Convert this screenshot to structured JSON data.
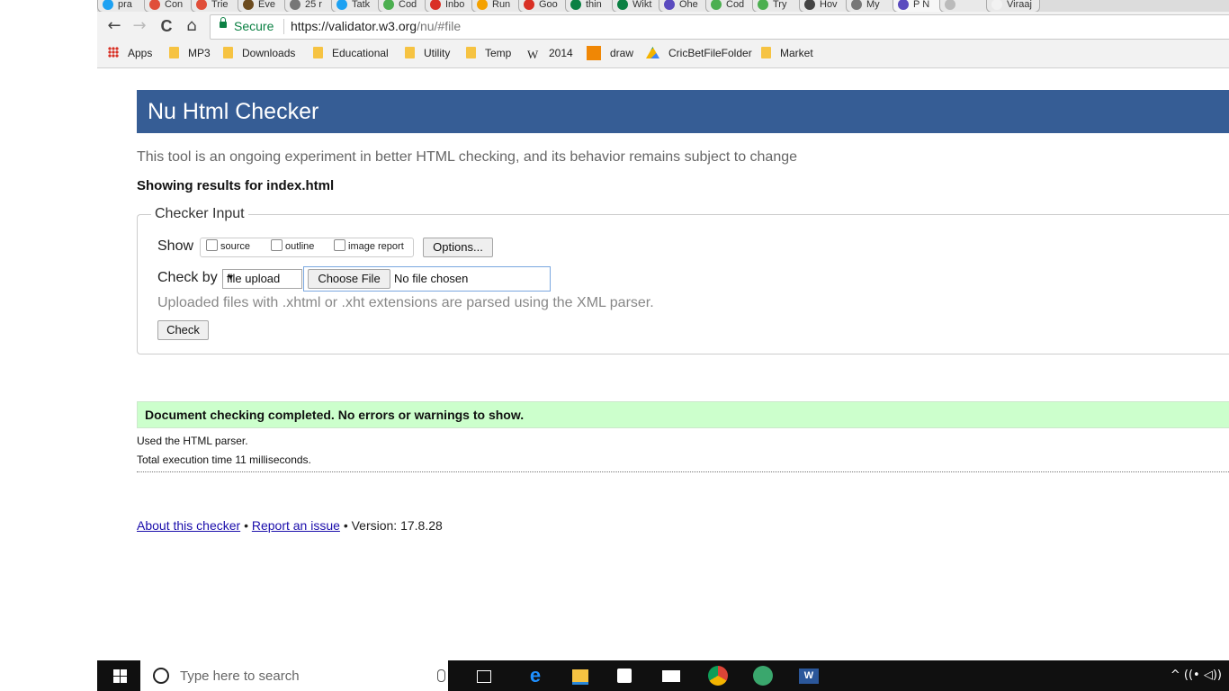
{
  "browser": {
    "tabs": [
      {
        "label": "pra",
        "color": "#1da1f2"
      },
      {
        "label": "Con",
        "color": "#e04e39"
      },
      {
        "label": "Trie",
        "color": "#e04e39"
      },
      {
        "label": "Eve",
        "color": "#6d4c1f"
      },
      {
        "label": "25 r",
        "color": "#777777"
      },
      {
        "label": "Tatk",
        "color": "#1da1f2"
      },
      {
        "label": "Cod",
        "color": "#4caf50"
      },
      {
        "label": "Inbo",
        "color": "#d93025"
      },
      {
        "label": "Run",
        "color": "#f4a100"
      },
      {
        "label": "Goo",
        "color": "#d93025"
      },
      {
        "label": "thin",
        "color": "#0b8043"
      },
      {
        "label": "Wikt",
        "color": "#0b8043"
      },
      {
        "label": "Ohe",
        "color": "#5b4bbf"
      },
      {
        "label": "Cod",
        "color": "#4caf50"
      },
      {
        "label": "Try",
        "color": "#4caf50"
      },
      {
        "label": "Hov",
        "color": "#444444"
      },
      {
        "label": "My",
        "color": "#777777"
      },
      {
        "label": "P N",
        "color": "#5b4bbf"
      },
      {
        "label": "",
        "color": "#bbbbbb"
      },
      {
        "label": "Viraaj",
        "color": "#f2f2f2"
      }
    ],
    "nav": {
      "back": "←",
      "forward": "→",
      "reload": "C",
      "home": "⌂"
    },
    "address": {
      "secure_label": "Secure",
      "url_host": "https://validator.w3.org",
      "url_path": "/nu/#file"
    },
    "bookmarks": [
      {
        "label": "Apps",
        "icon": "apps-grid-icon"
      },
      {
        "label": "MP3",
        "icon": "folder-icon"
      },
      {
        "label": "Downloads",
        "icon": "folder-icon"
      },
      {
        "label": "Educational",
        "icon": "folder-icon"
      },
      {
        "label": "Utility",
        "icon": "folder-icon"
      },
      {
        "label": "Temp",
        "icon": "folder-icon"
      },
      {
        "label": "2014",
        "icon": "wikipedia-icon"
      },
      {
        "label": "draw",
        "icon": "draw-icon"
      },
      {
        "label": "CricBetFileFolder",
        "icon": "drive-icon"
      },
      {
        "label": "Market",
        "icon": "folder-icon"
      }
    ]
  },
  "page": {
    "title": "Nu Html Checker",
    "intro": "This tool is an ongoing experiment in better HTML checking, and its behavior remains subject to change",
    "showing": "Showing results for index.html",
    "checker": {
      "legend": "Checker Input",
      "show_label": "Show",
      "checkboxes": [
        "source",
        "outline",
        "image report"
      ],
      "options_button": "Options...",
      "check_by_label": "Check by",
      "check_by_value": "file upload",
      "choose_file_button": "Choose File",
      "file_status": "No file chosen",
      "hint": "Uploaded files with .xhtml or .xht extensions are parsed using the XML parser.",
      "check_button": "Check"
    },
    "result": {
      "success_message": "Document checking completed. No errors or warnings to show.",
      "parser_line": "Used the HTML parser.",
      "time_line": "Total execution time 11 milliseconds."
    },
    "footer": {
      "about_link": "About this checker",
      "separator": "•",
      "report_link": "Report an issue",
      "version": "Version: 17.8.28"
    },
    "colors": {
      "header": "#365d95",
      "success_bg": "#ccffcc"
    }
  },
  "taskbar": {
    "search_placeholder": "Type here to search",
    "pinned": [
      "task-view-icon",
      "edge-icon",
      "file-explorer-icon",
      "store-icon",
      "mail-icon",
      "chrome-icon",
      "app-icon",
      "word-icon"
    ],
    "tray": "^ ((• ◁))"
  }
}
